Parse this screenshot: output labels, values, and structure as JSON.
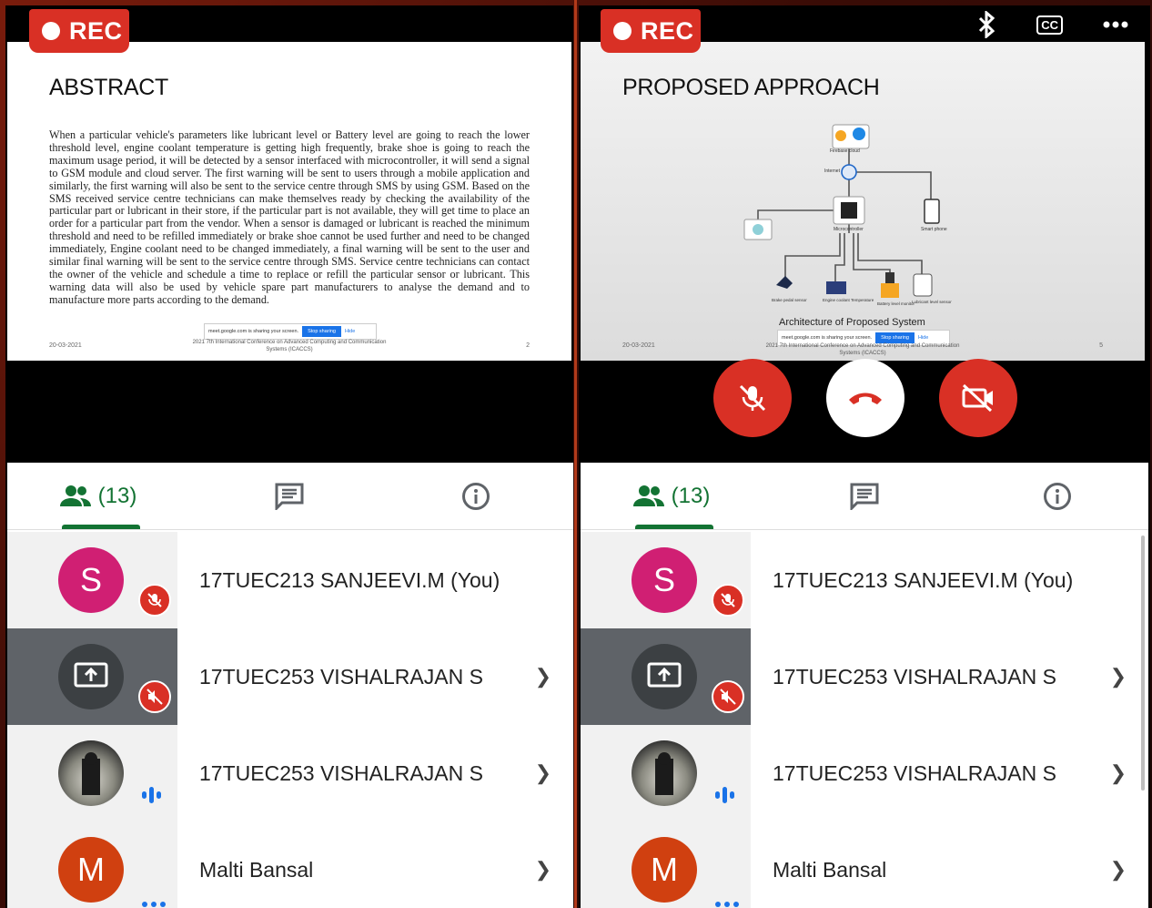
{
  "left_screen": {
    "rec_label": "REC",
    "slide": {
      "title": "ABSTRACT",
      "body": "When a particular vehicle's parameters like lubricant level or Battery level are going to reach the lower threshold level, engine coolant temperature is getting high frequently, brake shoe is going to reach the maximum usage period, it will be detected by a sensor interfaced with microcontroller, it will send a signal to GSM module and cloud server. The first warning will be sent to users through a mobile application and similarly, the first warning will also be sent to the service centre through SMS by using GSM. Based on the SMS received service centre technicians can make themselves ready by checking the availability of the particular part or lubricant in their store, if the particular part is not available, they will get time to place an order for a particular part from the vendor. When a sensor is damaged or lubricant is reached the minimum threshold and need to be refilled immediately or brake shoe cannot be used further and need to be changed immediately, Engine coolant need to be changed immediately, a final warning will be sent to the user and similar final warning will be sent to the service centre through SMS. Service centre technicians can contact the owner of the vehicle and schedule a time to replace or refill the particular sensor or lubricant. This warning data will also be used by vehicle spare part manufacturers to analyse the demand and to manufacture more parts according to the demand.",
      "date": "20-03-2021",
      "page": "2",
      "conference": "2021 7th International Conference on Advanced Computing and Communication Systems (ICACCS)",
      "share_banner": {
        "text": "meet.google.com is sharing your screen.",
        "stop": "Stop sharing",
        "hide": "Hide"
      }
    },
    "tabs": {
      "people_count": "(13)"
    },
    "participants": [
      {
        "initial": "S",
        "name": "17TUEC213 SANJEEVI.M (You)"
      },
      {
        "initial": "",
        "name": "17TUEC253 VISHALRAJAN S"
      },
      {
        "initial": "",
        "name": "17TUEC253 VISHALRAJAN S"
      },
      {
        "initial": "M",
        "name": "Malti Bansal"
      }
    ]
  },
  "right_screen": {
    "rec_label": "REC",
    "top_icons": [
      "bluetooth-icon",
      "closed-caption-icon",
      "more-icon"
    ],
    "cc_label": "CC",
    "slide": {
      "title": "PROPOSED APPROACH",
      "caption": "Architecture of Proposed System",
      "date": "20-03-2021",
      "page": "5",
      "conference": "2021 7th International Conference on Advanced Computing and Communication Systems (ICACCS)",
      "share_banner": {
        "text": "meet.google.com is sharing your screen.",
        "stop": "Stop sharing",
        "hide": "Hide"
      },
      "diagram_labels": {
        "cloud": "Firebase cloud",
        "internet": "Internet",
        "micro": "Microcontroller",
        "phone": "Smart phone",
        "brake": "Brake pedal sensor",
        "coolant": "Engine coolant Temperature",
        "battery": "Battery level monitor",
        "lubricant": "Lubricant level sensor",
        "gsm": "GSM"
      }
    },
    "tabs": {
      "people_count": "(13)"
    },
    "participants": [
      {
        "initial": "S",
        "name": "17TUEC213 SANJEEVI.M (You)"
      },
      {
        "initial": "",
        "name": "17TUEC253 VISHALRAJAN S"
      },
      {
        "initial": "",
        "name": "17TUEC253 VISHALRAJAN S"
      },
      {
        "initial": "M",
        "name": "Malti Bansal"
      }
    ]
  },
  "colors": {
    "rec_red": "#d93025",
    "accent_green": "#137333",
    "avatar_pink": "#d01f73",
    "avatar_orange": "#d04010",
    "audio_blue": "#1a73e8"
  }
}
